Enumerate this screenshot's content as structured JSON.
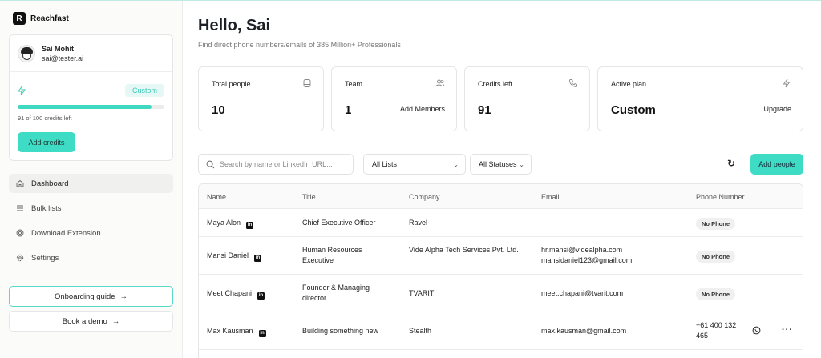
{
  "brand": {
    "name": "Reachfast",
    "logo_letter": "R"
  },
  "account": {
    "name": "Sai Mohit",
    "email": "sai@tester.ai",
    "plan_badge": "Custom",
    "credits_used_fraction": 0.91,
    "credits_text": "91 of 100 credits left",
    "add_credits_label": "Add credits"
  },
  "nav": {
    "items": [
      {
        "label": "Dashboard",
        "icon": "home-icon",
        "active": true
      },
      {
        "label": "Bulk lists",
        "icon": "list-icon",
        "active": false
      },
      {
        "label": "Download Extension",
        "icon": "chrome-icon",
        "active": false
      },
      {
        "label": "Settings",
        "icon": "gear-icon",
        "active": false
      }
    ]
  },
  "sidebar_buttons": {
    "onboarding": "Onboarding guide",
    "demo": "Book a demo"
  },
  "header": {
    "greeting": "Hello, Sai",
    "subtitle": "Find direct phone numbers/emails of 385 Million+ Professionals"
  },
  "stats": [
    {
      "label": "Total people",
      "value": "10",
      "action": "",
      "icon": "database-icon"
    },
    {
      "label": "Team",
      "value": "1",
      "action": "Add Members",
      "icon": "users-icon"
    },
    {
      "label": "Credits left",
      "value": "91",
      "action": "",
      "icon": "phone-icon"
    },
    {
      "label": "Active plan",
      "value": "Custom",
      "action": "Upgrade",
      "icon": "bolt-icon"
    }
  ],
  "toolbar": {
    "search_placeholder": "Search by name or LinkedIn URL...",
    "list_filter": "All Lists",
    "status_filter": "All Statuses",
    "add_people_label": "Add people"
  },
  "table": {
    "columns": [
      "Name",
      "Title",
      "Company",
      "Email",
      "Phone Number"
    ],
    "rows": [
      {
        "name": "Maya Alon",
        "title": "Chief Executive Officer",
        "company": "Ravel",
        "email": "",
        "phone": "No Phone"
      },
      {
        "name": "Mansi Daniel",
        "title": "Human Resources Executive",
        "company": "Vide Alpha Tech Services Pvt. Ltd.",
        "email": "hr.mansi@videalpha.com\nmansidaniel123@gmail.com",
        "phone": "No Phone"
      },
      {
        "name": "Meet Chapani",
        "title": "Founder & Managing director",
        "company": "TVARIT",
        "email": "meet.chapani@tvarit.com",
        "phone": "No Phone"
      },
      {
        "name": "Max Kausman",
        "title": "Building something new",
        "company": "Stealth",
        "email": "max.kausman@gmail.com",
        "phone": "+61 400 132 465"
      }
    ]
  }
}
